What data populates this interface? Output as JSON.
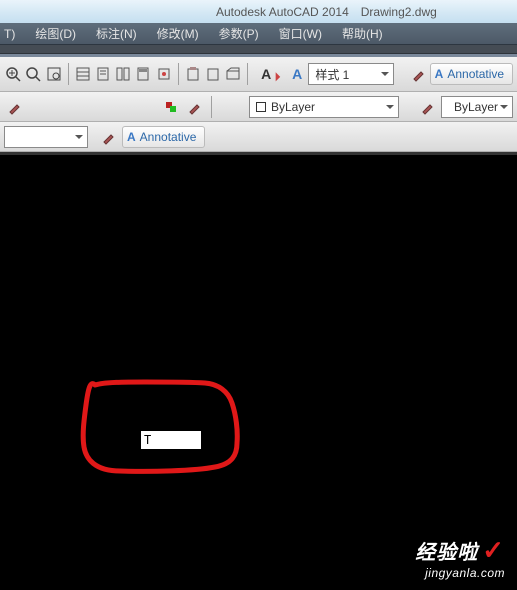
{
  "title": {
    "app": "Autodesk AutoCAD 2014",
    "doc": "Drawing2.dwg"
  },
  "menus": [
    {
      "label": "T)"
    },
    {
      "label": "绘图(D)"
    },
    {
      "label": "标注(N)"
    },
    {
      "label": "修改(M)"
    },
    {
      "label": "参数(P)"
    },
    {
      "label": "窗口(W)"
    },
    {
      "label": "帮助(H)"
    }
  ],
  "toolbar_row1": {
    "style_label": "样式 1",
    "annotative": "Annotative"
  },
  "toolbar_row2": {
    "layer": "ByLayer",
    "linetype": "ByLayer"
  },
  "toolbar_row3": {
    "annotative": "Annotative"
  },
  "command_input": "T",
  "watermark": {
    "line1": "经验啦",
    "line2": "jingyanla.com"
  },
  "icons": {
    "a_symbol": "A",
    "checkmark": "✓"
  }
}
